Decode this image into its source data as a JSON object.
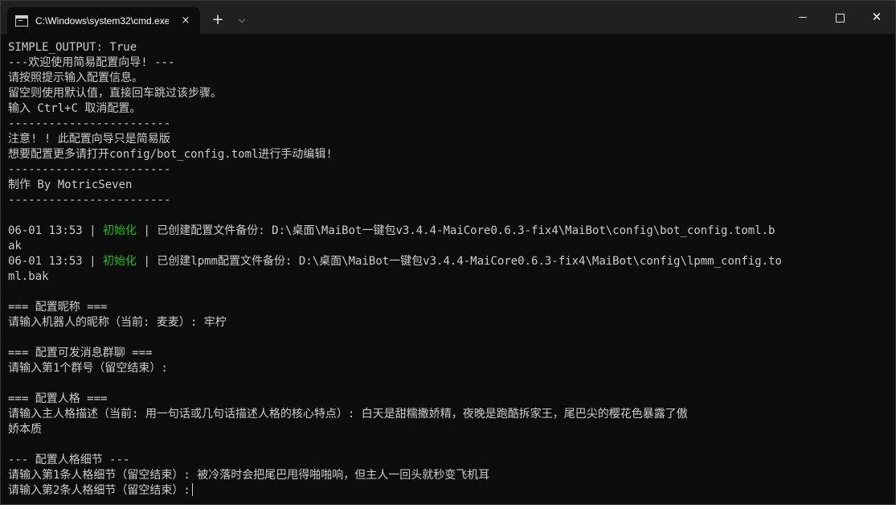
{
  "window": {
    "tab_title": "C:\\Windows\\system32\\cmd.exe",
    "tab_close": "×",
    "new_tab": "+",
    "tab_dropdown": "⌵",
    "close_glyph": "✕"
  },
  "terminal": {
    "lines": [
      "SIMPLE_OUTPUT: True",
      "---欢迎使用简易配置向导! ---",
      "请按照提示输入配置信息。",
      "留空则使用默认值，直接回车跳过该步骤。",
      "输入 Ctrl+C 取消配置。",
      "------------------------",
      "注意! ! 此配置向导只是简易版",
      "想要配置更多请打开config/bot_config.toml进行手动编辑!",
      "------------------------",
      "制作 By MotricSeven",
      "------------------------",
      "",
      "",
      "ak",
      "",
      "ml.bak",
      "",
      "=== 配置昵称 ===",
      "请输入机器人的昵称（当前: 麦麦）: 牢柠",
      "",
      "=== 配置可发消息群聊 ===",
      "请输入第1个群号（留空结束）:",
      "",
      "=== 配置人格 ===",
      "请输入主人格描述（当前: 用一句话或几句话描述人格的核心特点）: 白天是甜糯撒娇精，夜晚是跑酷拆家王，尾巴尖的樱花色暴露了傲",
      "娇本质",
      "",
      "--- 配置人格细节 ---",
      "请输入第1条人格细节（留空结束）: 被冷落时会把尾巴甩得啪啪响，但主人一回头就秒变飞机耳",
      "请输入第2条人格细节（留空结束）:"
    ],
    "log1": {
      "time": "06-01 13:53",
      "sep1": " | ",
      "level": "初始化",
      "sep2": " | ",
      "message": "已创建配置文件备份: D:\\桌面\\MaiBot一键包v3.4.4-MaiCore0.6.3-fix4\\MaiBot\\config\\bot_config.toml.b"
    },
    "log2": {
      "time": "06-01 13:53",
      "sep1": " | ",
      "level": "初始化",
      "sep2": " | ",
      "message": "已创建lpmm配置文件备份: D:\\桌面\\MaiBot一键包v3.4.4-MaiCore0.6.3-fix4\\MaiBot\\config\\lpmm_config.to"
    },
    "colors": {
      "background": "#0c0c0c",
      "text": "#cccccc",
      "level": "#16c60c",
      "titlebar": "#202020"
    }
  }
}
